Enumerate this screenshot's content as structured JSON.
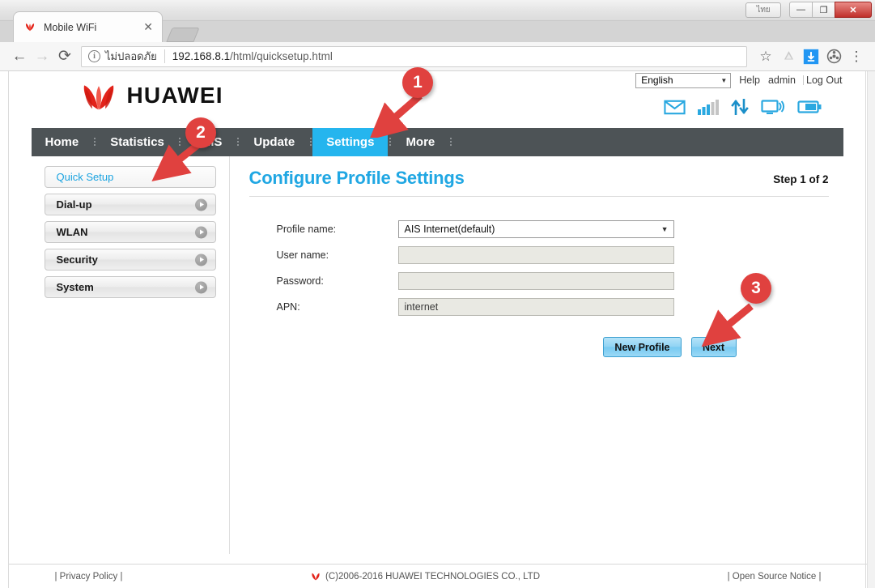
{
  "window": {
    "ime_button": "ไทย",
    "minimize": "—",
    "maximize": "❐",
    "close": "✕"
  },
  "browser": {
    "tab": {
      "title": "Mobile WiFi",
      "close": "✕",
      "favicon_icon": "huawei-favicon"
    },
    "newtab_icon": "new-tab-button",
    "back_icon": "←",
    "forward_icon": "→",
    "reload_icon": "⟳",
    "omnibox": {
      "info_icon": "i",
      "security_text": "ไม่ปลอดภัย",
      "url_host": "192.168.8.1",
      "url_path": "/html/quicksetup.html"
    },
    "star_icon": "☆",
    "drive_icon": "drive-icon",
    "download_icon": "download-icon",
    "extension_icon": "film-reel-extension-icon",
    "menu_icon": "⋮"
  },
  "page_header": {
    "brand": "HUAWEI",
    "logo_icon": "huawei-logo",
    "language": "English",
    "language_caret": "▼",
    "help": "Help",
    "admin": "admin",
    "logout": "Log Out",
    "status_icons": [
      {
        "name": "sms-envelope-icon"
      },
      {
        "name": "signal-strength-icon"
      },
      {
        "name": "data-transfer-icon"
      },
      {
        "name": "wifi-clients-icon"
      },
      {
        "name": "battery-icon"
      }
    ]
  },
  "nav": {
    "items": [
      {
        "label": "Home",
        "active": false
      },
      {
        "label": "Statistics",
        "active": false
      },
      {
        "label": "SMS",
        "active": false
      },
      {
        "label": "Update",
        "active": false
      },
      {
        "label": "Settings",
        "active": true
      },
      {
        "label": "More",
        "active": false
      }
    ]
  },
  "sidebar": {
    "items": [
      {
        "label": "Quick Setup",
        "active": true,
        "arrow": false
      },
      {
        "label": "Dial-up",
        "active": false,
        "arrow": true
      },
      {
        "label": "WLAN",
        "active": false,
        "arrow": true
      },
      {
        "label": "Security",
        "active": false,
        "arrow": true
      },
      {
        "label": "System",
        "active": false,
        "arrow": true
      }
    ]
  },
  "content": {
    "title": "Configure Profile Settings",
    "step": "Step 1 of 2",
    "fields": {
      "profile_name_label": "Profile name:",
      "profile_name_value": "AIS Internet(default)",
      "profile_name_caret": "▼",
      "user_name_label": "User name:",
      "user_name_value": "",
      "password_label": "Password:",
      "password_value": "",
      "apn_label": "APN:",
      "apn_value": "internet"
    },
    "buttons": {
      "new_profile": "New Profile",
      "next": "Next"
    }
  },
  "footer": {
    "privacy": "| Privacy Policy |",
    "copyright": "(C)2006-2016 HUAWEI TECHNOLOGIES CO., LTD",
    "open_source": "| Open Source Notice |",
    "logo_icon": "huawei-footer-logo"
  },
  "markers": [
    {
      "number": "1"
    },
    {
      "number": "2"
    },
    {
      "number": "3"
    }
  ],
  "colors": {
    "accent_blue": "#25b5ee",
    "title_blue": "#20a7e3",
    "nav_dark": "#4d5356",
    "marker_red": "#e0413f",
    "huawei_red": "#e2231a"
  }
}
